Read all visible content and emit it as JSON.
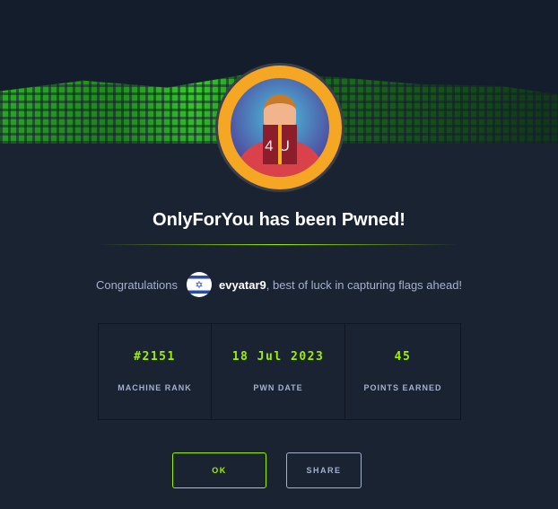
{
  "title": "OnlyForYou has been Pwned!",
  "badge_text": "4U",
  "congrats": {
    "prefix": "Congratulations",
    "username": "evyatar9",
    "suffix": ", best of luck in capturing flags ahead!",
    "flag_icon": "israel-flag"
  },
  "stats": [
    {
      "value": "#2151",
      "label": "MACHINE RANK"
    },
    {
      "value": "18 Jul 2023",
      "label": "PWN DATE"
    },
    {
      "value": "45",
      "label": "POINTS EARNED"
    }
  ],
  "buttons": {
    "ok": "OK",
    "share": "SHARE"
  },
  "colors": {
    "accent": "#9fef00",
    "bg": "#1a2332"
  }
}
